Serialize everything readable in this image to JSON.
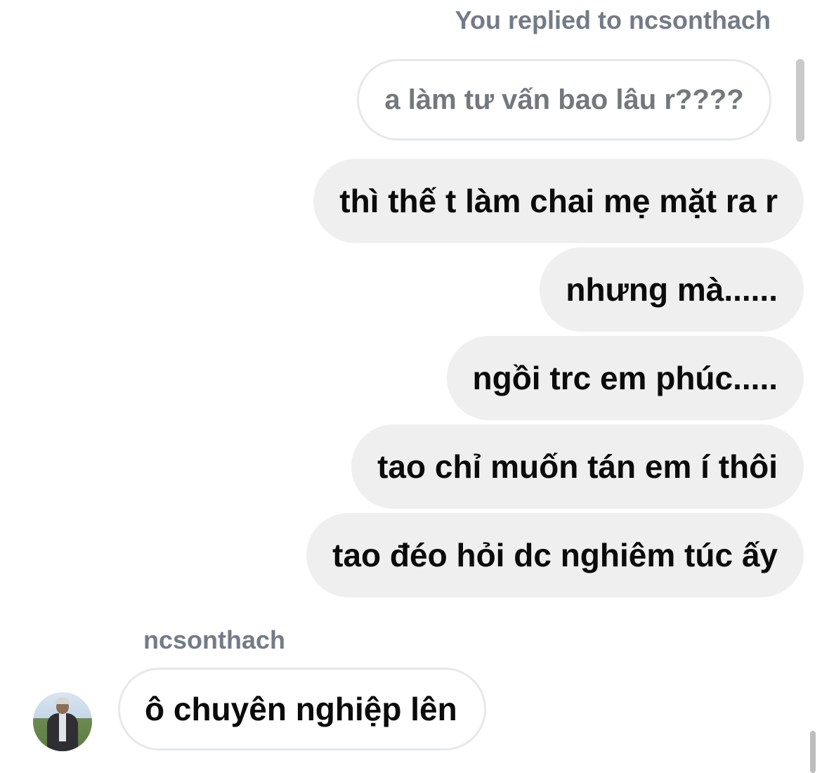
{
  "reply_context": {
    "header": "You replied to ncsonthach",
    "quoted_message": "a làm tư vấn bao lâu r????"
  },
  "outgoing_messages": [
    "thì thế t làm chai mẹ mặt ra r",
    "nhưng mà......",
    "ngồi trc em phúc.....",
    "tao chỉ muốn tán em í thôi",
    "tao đéo hỏi dc nghiêm túc ấy"
  ],
  "incoming": {
    "sender": "ncsonthach",
    "message": "ô chuyên nghiệp lên"
  },
  "colors": {
    "outgoing_bubble": "#efefef",
    "bubble_border": "#e6e8ea",
    "meta_text": "#737b87",
    "message_text": "#0b0b0b"
  }
}
